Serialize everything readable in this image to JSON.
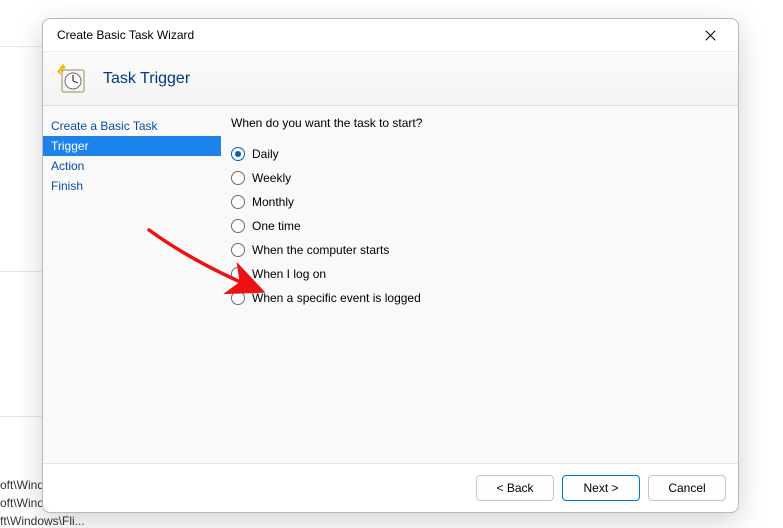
{
  "bg": {
    "line1": "oft\\Wind",
    "line2": "oft\\Windows\\U...",
    "line3": "ft\\Windows\\Fli..."
  },
  "dialog": {
    "title": "Create Basic Task Wizard",
    "page_title": "Task Trigger"
  },
  "steps": [
    {
      "label": "Create a Basic Task",
      "selected": false
    },
    {
      "label": "Trigger",
      "selected": true
    },
    {
      "label": "Action",
      "selected": false
    },
    {
      "label": "Finish",
      "selected": false
    }
  ],
  "content": {
    "question": "When do you want the task to start?",
    "options": [
      {
        "label": "Daily",
        "value": "daily",
        "checked": true
      },
      {
        "label": "Weekly",
        "value": "weekly",
        "checked": false
      },
      {
        "label": "Monthly",
        "value": "monthly",
        "checked": false
      },
      {
        "label": "One time",
        "value": "onetime",
        "checked": false
      },
      {
        "label": "When the computer starts",
        "value": "startup",
        "checked": false
      },
      {
        "label": "When I log on",
        "value": "logon",
        "checked": false
      },
      {
        "label": "When a specific event is logged",
        "value": "event",
        "checked": false
      }
    ]
  },
  "buttons": {
    "back": "< Back",
    "next": "Next >",
    "cancel": "Cancel"
  }
}
